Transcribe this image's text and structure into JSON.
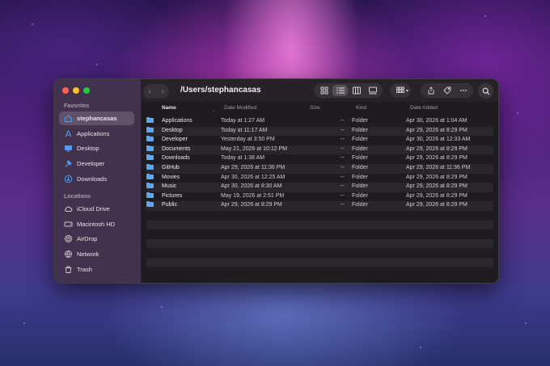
{
  "window": {
    "path_title": "/Users/stephancasas"
  },
  "sidebar": {
    "favorites_label": "Favorites",
    "favorites": [
      {
        "label": "stephancasas",
        "icon": "home-icon",
        "active": true
      },
      {
        "label": "Applications",
        "icon": "applications-icon"
      },
      {
        "label": "Desktop",
        "icon": "desktop-icon"
      },
      {
        "label": "Developer",
        "icon": "hammer-icon"
      },
      {
        "label": "Downloads",
        "icon": "download-icon"
      }
    ],
    "locations_label": "Locations",
    "locations": [
      {
        "label": "iCloud Drive",
        "icon": "cloud-icon"
      },
      {
        "label": "Macintosh HD",
        "icon": "drive-icon"
      },
      {
        "label": "AirDrop",
        "icon": "airdrop-icon"
      },
      {
        "label": "Network",
        "icon": "network-icon"
      },
      {
        "label": "Trash",
        "icon": "trash-icon"
      }
    ]
  },
  "columns": {
    "name": "Name",
    "date_modified": "Date Modified",
    "size": "Size",
    "kind": "Kind",
    "date_added": "Date Added"
  },
  "files": [
    {
      "name": "Applications",
      "modified": "Today at 1:27 AM",
      "size": "--",
      "kind": "Folder",
      "added": "Apr 30, 2026 at 1:04 AM"
    },
    {
      "name": "Desktop",
      "modified": "Today at 11:17 AM",
      "size": "--",
      "kind": "Folder",
      "added": "Apr 29, 2026 at 8:29 PM"
    },
    {
      "name": "Developer",
      "modified": "Yesterday at 3:50 PM",
      "size": "--",
      "kind": "Folder",
      "added": "Apr 30, 2026 at 12:33 AM"
    },
    {
      "name": "Documents",
      "modified": "May 21, 2026 at 10:12 PM",
      "size": "--",
      "kind": "Folder",
      "added": "Apr 29, 2026 at 8:29 PM"
    },
    {
      "name": "Downloads",
      "modified": "Today at 1:38 AM",
      "size": "--",
      "kind": "Folder",
      "added": "Apr 29, 2026 at 8:29 PM"
    },
    {
      "name": "GitHub",
      "modified": "Apr 29, 2026 at 11:36 PM",
      "size": "--",
      "kind": "Folder",
      "added": "Apr 29, 2026 at 11:36 PM"
    },
    {
      "name": "Movies",
      "modified": "Apr 30, 2026 at 12:25 AM",
      "size": "--",
      "kind": "Folder",
      "added": "Apr 29, 2026 at 8:29 PM"
    },
    {
      "name": "Music",
      "modified": "Apr 30, 2026 at 8:30 AM",
      "size": "--",
      "kind": "Folder",
      "added": "Apr 29, 2026 at 8:29 PM"
    },
    {
      "name": "Pictures",
      "modified": "May 19, 2026 at 2:51 PM",
      "size": "--",
      "kind": "Folder",
      "added": "Apr 29, 2026 at 8:29 PM"
    },
    {
      "name": "Public",
      "modified": "Apr 29, 2026 at 8:29 PM",
      "size": "--",
      "kind": "Folder",
      "added": "Apr 29, 2026 at 8:29 PM"
    }
  ],
  "colors": {
    "folder": "#5ba8f5",
    "accent": "#3d8ef0"
  }
}
